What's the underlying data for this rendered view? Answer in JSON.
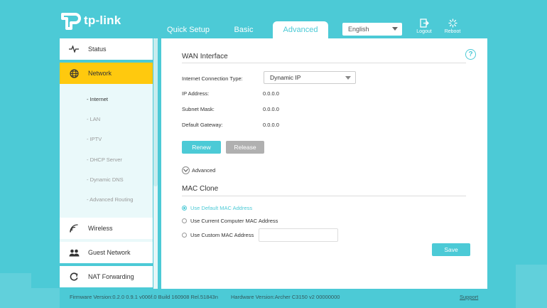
{
  "header": {
    "logo_text": "tp-link",
    "tabs": [
      {
        "label": "Quick Setup"
      },
      {
        "label": "Basic"
      },
      {
        "label": "Advanced"
      }
    ],
    "language": "English",
    "logout_label": "Logout",
    "reboot_label": "Reboot"
  },
  "sidebar": {
    "items": [
      {
        "label": "Status",
        "icon": "pulse-icon"
      },
      {
        "label": "Network",
        "icon": "globe-icon"
      },
      {
        "label": "Wireless",
        "icon": "wifi-icon"
      },
      {
        "label": "Guest Network",
        "icon": "users-icon"
      },
      {
        "label": "NAT Forwarding",
        "icon": "refresh-icon"
      }
    ],
    "sub_items": [
      {
        "label": "- Internet"
      },
      {
        "label": "- LAN"
      },
      {
        "label": "- IPTV"
      },
      {
        "label": "- DHCP Server"
      },
      {
        "label": "- Dynamic DNS"
      },
      {
        "label": "- Advanced Routing"
      }
    ]
  },
  "wan": {
    "title": "WAN Interface",
    "connection_type_label": "Internet Connection Type:",
    "connection_type_value": "Dynamic IP",
    "ip_label": "IP Address:",
    "ip_value": "0.0.0.0",
    "subnet_label": "Subnet Mask:",
    "subnet_value": "0.0.0.0",
    "gateway_label": "Default Gateway:",
    "gateway_value": "0.0.0.0",
    "renew_label": "Renew",
    "release_label": "Release",
    "advanced_label": "Advanced"
  },
  "mac": {
    "title": "MAC Clone",
    "option_default": "Use Default MAC Address",
    "option_current": "Use Current Computer MAC Address",
    "option_custom": "Use Custom MAC Address",
    "custom_value": "",
    "save_label": "Save"
  },
  "help_glyph": "?",
  "footer": {
    "firmware": "Firmware Version:0.2.0 0.9.1 v006f.0 Build 160908 Rel.51843n",
    "hardware": "Hardware Version:Archer C3150 v2 00000000",
    "support": "Support"
  },
  "colors": {
    "accent": "#4ccad6",
    "active_nav": "#ffc90e"
  }
}
